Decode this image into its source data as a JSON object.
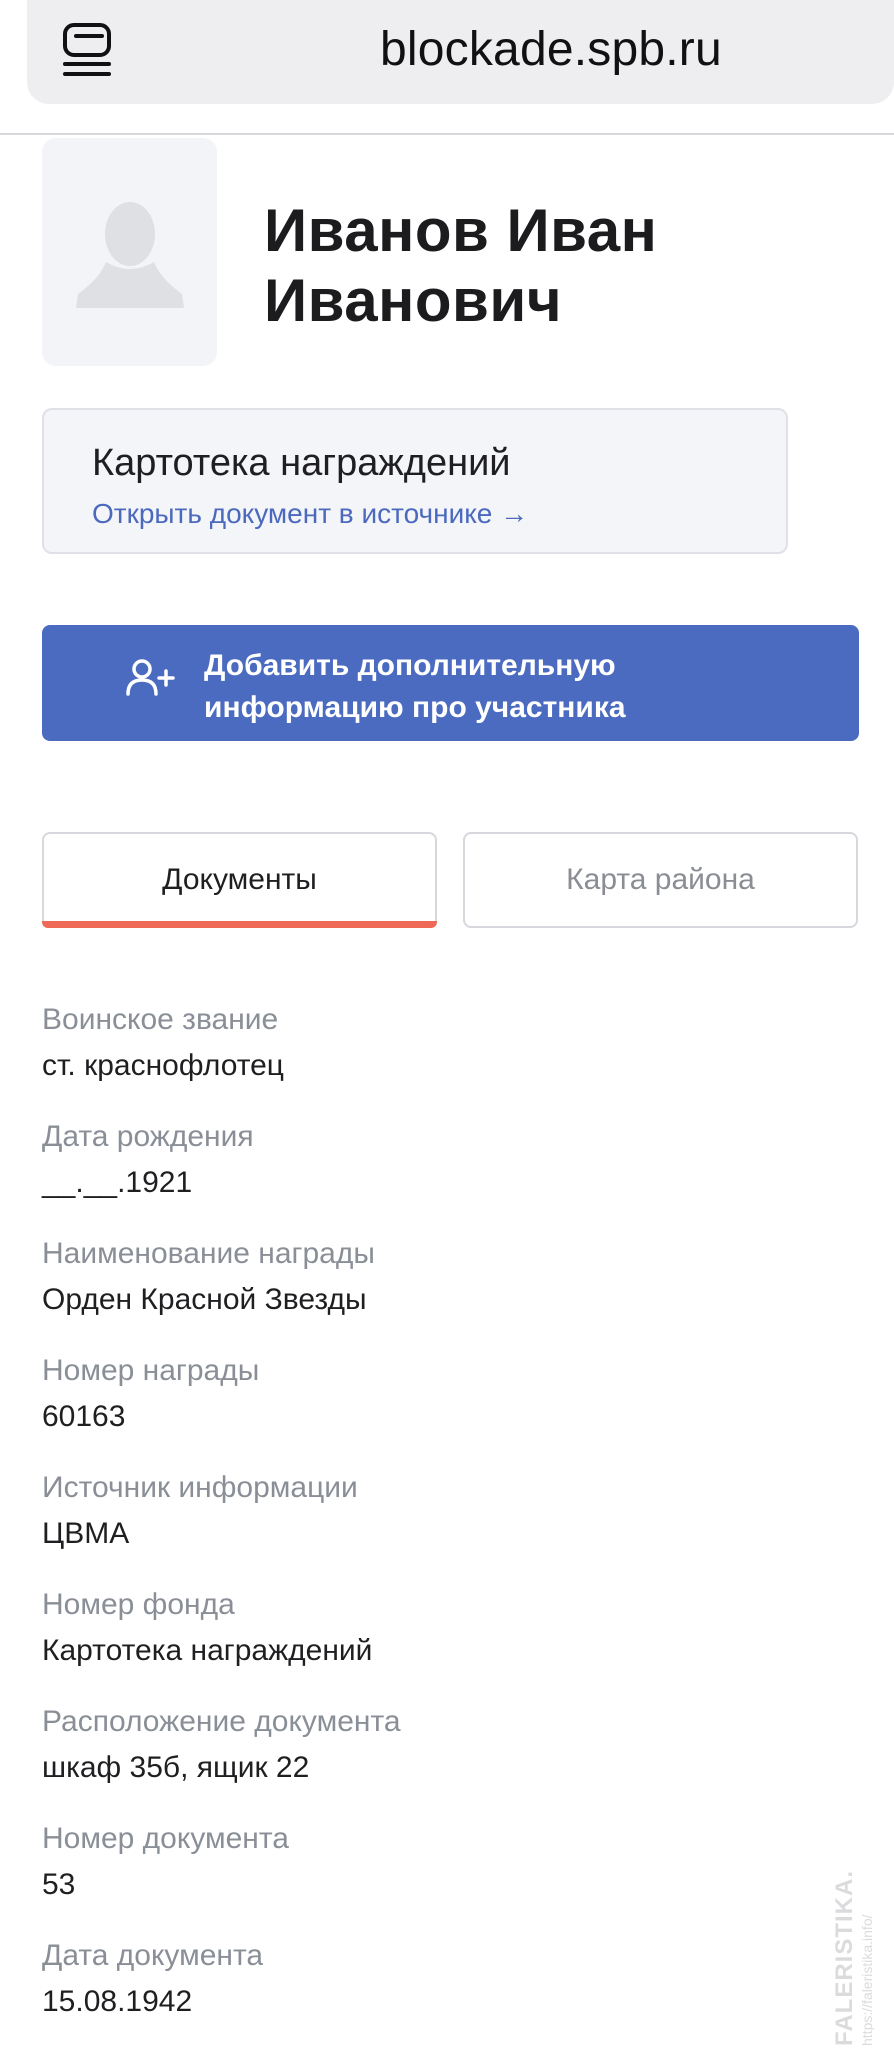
{
  "browser": {
    "url": "blockade.spb.ru",
    "menu_icon": "tabs-menu-icon"
  },
  "person": {
    "name": "Иванов Иван Иванович",
    "avatar_icon": "person-silhouette-icon"
  },
  "source_card": {
    "title": "Картотека награждений",
    "link": "Открыть документ в источнике →"
  },
  "add_info": {
    "label": "Добавить дополнительную информацию про участника",
    "icon": "add-person-icon"
  },
  "tabs": [
    {
      "label": "Документы",
      "active": true
    },
    {
      "label": "Карта района",
      "active": false
    }
  ],
  "fields": [
    {
      "label": "Воинское звание",
      "value": "ст. краснофлотец"
    },
    {
      "label": "Дата рождения",
      "value": "__.__.1921"
    },
    {
      "label": "Наименование награды",
      "value": "Орден Красной Звезды"
    },
    {
      "label": "Номер награды",
      "value": "60163"
    },
    {
      "label": "Источник информации",
      "value": "ЦВМА"
    },
    {
      "label": "Номер фонда",
      "value": "Картотека награждений"
    },
    {
      "label": "Расположение документа",
      "value": "шкаф 35б, ящик 22"
    },
    {
      "label": "Номер документа",
      "value": "53"
    },
    {
      "label": "Дата документа",
      "value": "15.08.1942"
    }
  ],
  "colors": {
    "accent_button": "#4a6bbf",
    "link": "#4b69bd",
    "tab_indicator": "#ef6a56",
    "label_gray": "#8a8f97"
  },
  "watermark": {
    "text": "FALERISTIKA.INFO https://faleristika.info/"
  }
}
